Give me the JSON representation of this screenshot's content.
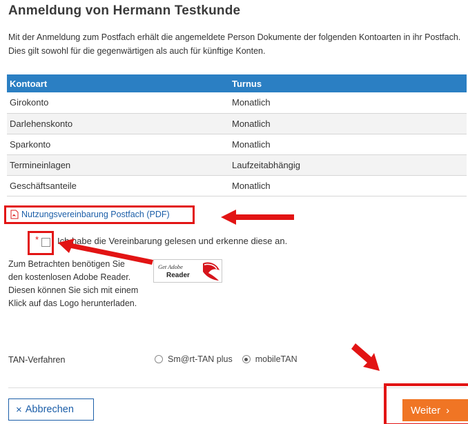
{
  "page": {
    "title": "Anmeldung von Hermann Testkunde",
    "intro": "Mit der Anmeldung zum Postfach erhält die angemeldete Person Dokumente der folgenden Kontoarten in ihr Postfach. Dies gilt sowohl für die gegenwärtigen als auch für künftige Konten."
  },
  "table": {
    "headers": [
      "Kontoart",
      "Turnus"
    ],
    "rows": [
      [
        "Girokonto",
        "Monatlich"
      ],
      [
        "Darlehenskonto",
        "Monatlich"
      ],
      [
        "Sparkonto",
        "Monatlich"
      ],
      [
        "Termineinlagen",
        "Laufzeitabhängig"
      ],
      [
        "Geschäftsanteile",
        "Monatlich"
      ]
    ]
  },
  "pdf": {
    "link_label": "Nutzungsvereinbarung Postfach (PDF)",
    "icon": "pdf-icon"
  },
  "agreement": {
    "required_mark": "*",
    "label": "Ich habe die Vereinbarung gelesen und erkenne diese an.",
    "checked": false
  },
  "adobe": {
    "text": "Zum Betrachten benötigen Sie den kostenlosen Adobe Reader. Diesen können Sie sich mit einem Klick auf das Logo herunterladen.",
    "logo_line1": "Get Adobe",
    "logo_line2": "Reader"
  },
  "tan": {
    "label": "TAN-Verfahren",
    "options": [
      {
        "label": "Sm@rt-TAN plus",
        "selected": false
      },
      {
        "label": "mobileTAN",
        "selected": true
      }
    ]
  },
  "buttons": {
    "cancel_icon": "×",
    "cancel_label": "Abbrechen",
    "next_label": "Weiter",
    "next_icon": "›"
  },
  "colors": {
    "accent_blue": "#2b7fc3",
    "link_blue": "#1b5ea8",
    "orange": "#f07524",
    "annotation_red": "#e21414"
  }
}
